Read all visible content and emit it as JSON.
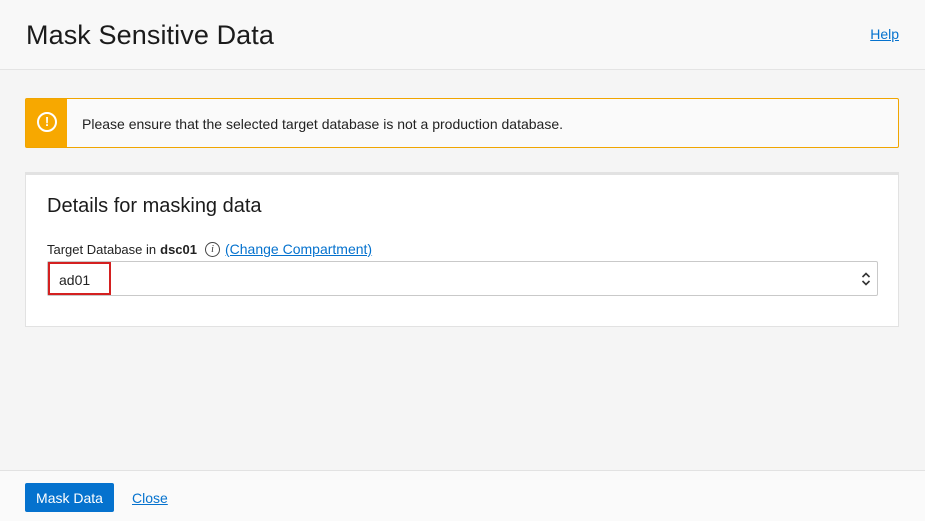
{
  "header": {
    "title": "Mask Sensitive Data",
    "help_label": "Help"
  },
  "alert": {
    "icon": "warning-icon",
    "message": "Please ensure that the selected target database is not a production database.",
    "color": "#f7a800"
  },
  "details": {
    "title": "Details for masking data",
    "field_label": "Target Database in",
    "compartment": "dsc01",
    "info_icon": "info-icon",
    "info_glyph": "i",
    "change_link": "(Change Compartment)",
    "selected_value": "ad01"
  },
  "footer": {
    "primary_label": "Mask Data",
    "close_label": "Close"
  },
  "colors": {
    "accent": "#0572ce",
    "highlight": "#d42020"
  }
}
